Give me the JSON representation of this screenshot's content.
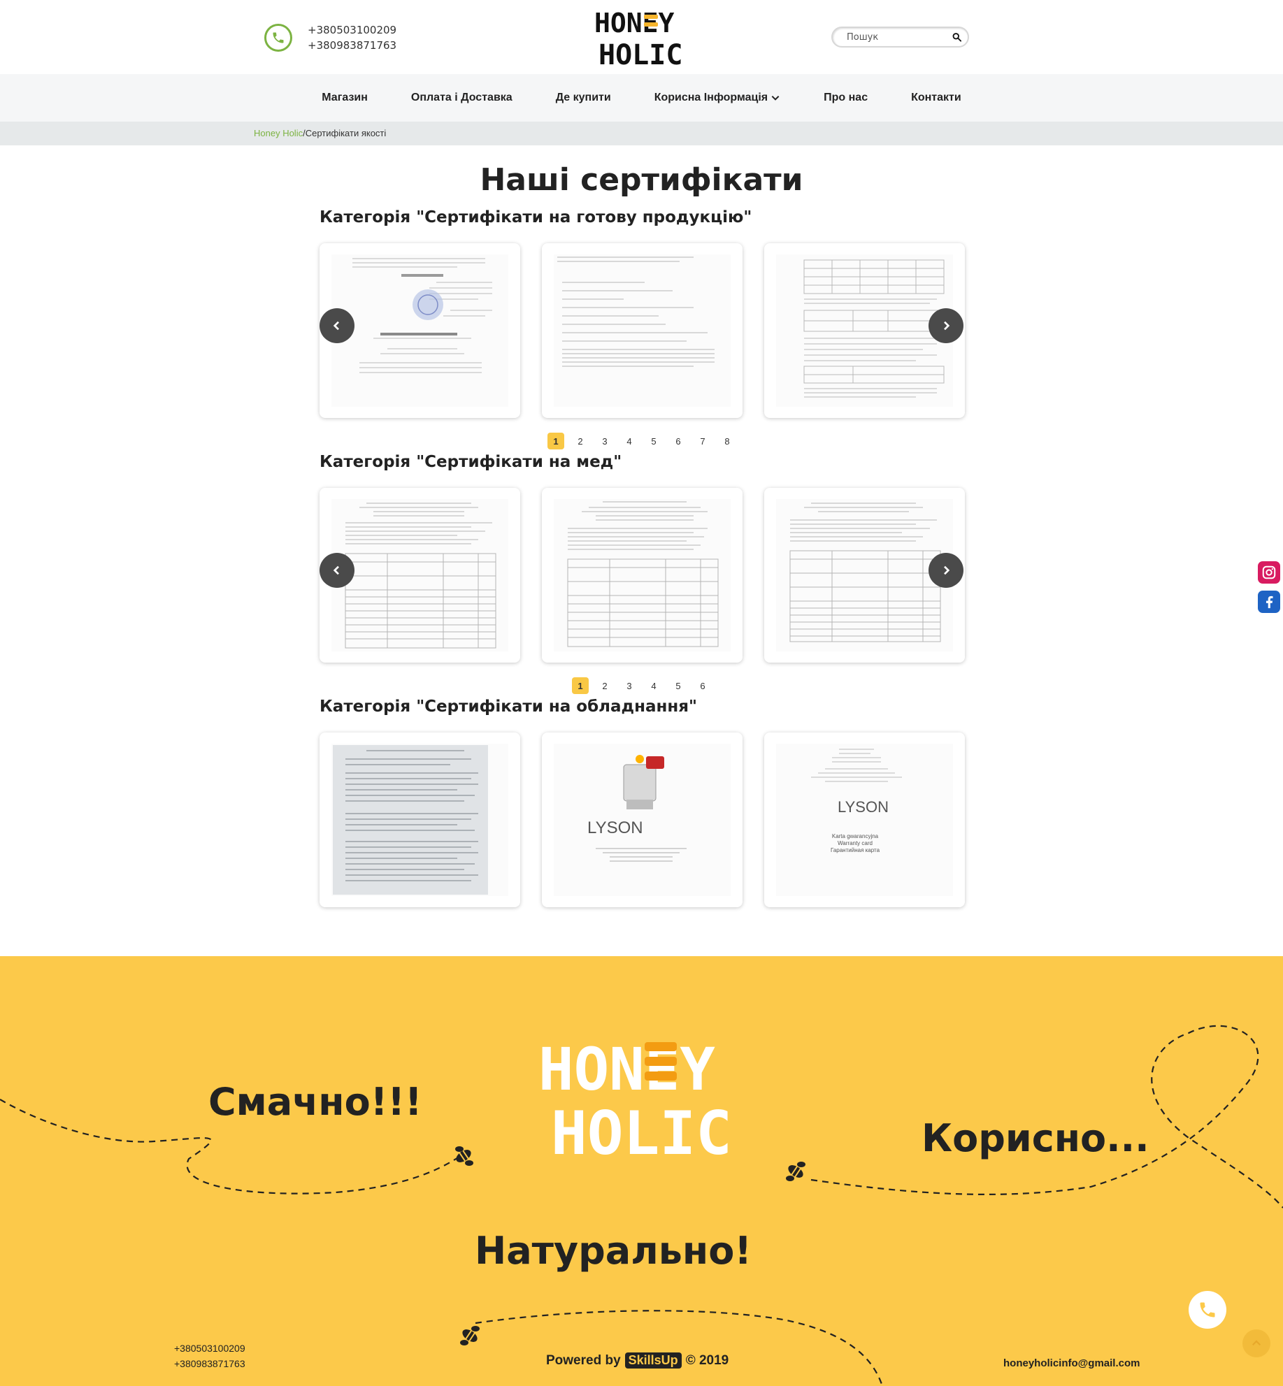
{
  "header": {
    "phones": [
      "+380503100209",
      "+380983871763"
    ],
    "logo_line1": "HONEY",
    "logo_line2": "HOLIC",
    "search_placeholder": "Пошук"
  },
  "nav": {
    "items": [
      {
        "label": "Магазин"
      },
      {
        "label": "Оплата і Доставка"
      },
      {
        "label": "Де купити"
      },
      {
        "label": "Корисна Інформація"
      },
      {
        "label": "Про нас"
      },
      {
        "label": "Контакти"
      }
    ]
  },
  "breadcrumb": {
    "home": "Honey Holic",
    "separator": "/",
    "current": "Сертифікати якості"
  },
  "page_title": "Наші сертифікати",
  "categories": [
    {
      "title": "Категорія \"Сертифікати на готову продукцію\"",
      "pages": [
        "1",
        "2",
        "3",
        "4",
        "5",
        "6",
        "7",
        "8"
      ],
      "active_page": "1"
    },
    {
      "title": "Категорія \"Сертифікати на мед\"",
      "pages": [
        "1",
        "2",
        "3",
        "4",
        "5",
        "6"
      ],
      "active_page": "1"
    },
    {
      "title": "Категорія \"Сертифікати на обладнання\""
    }
  ],
  "equipment_docs": {
    "brand": "LYSON",
    "warranty_lines": [
      "Karta gwarancyjna",
      "Warranty card",
      "Гарантийная карта"
    ]
  },
  "footer": {
    "slogans": [
      "Смачно!!!",
      "Корисно...",
      "Натурально!"
    ],
    "phones": [
      "+380503100209",
      "+380983871763"
    ],
    "powered_prefix": "Powered by",
    "powered_brand": "SkillsUp",
    "powered_suffix": "© 2019",
    "email": "honeyholicinfo@gmail.com"
  },
  "colors": {
    "accent_yellow": "#fcc94a",
    "green": "#7cb342",
    "dark": "#222222"
  },
  "icons": [
    "phone-icon",
    "search-icon",
    "chevron-down-icon",
    "chevron-left-icon",
    "chevron-right-icon",
    "instagram-icon",
    "facebook-icon",
    "bee-icon",
    "arrow-up-icon"
  ]
}
